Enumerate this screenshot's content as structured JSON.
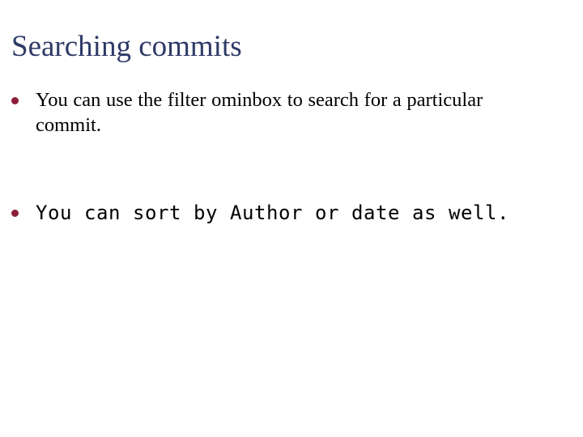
{
  "slide": {
    "title": "Searching commits",
    "title_color": "#2e3a66",
    "background_color": "#ffffff",
    "text_color": "#000000",
    "bullet_color": "#8c1f38",
    "bullets": [
      {
        "text": "You can use the filter ominbox to search for a particular commit.",
        "style": "serif"
      },
      {
        "text": "You can sort by Author or date as well.",
        "style": "monospace"
      }
    ]
  }
}
